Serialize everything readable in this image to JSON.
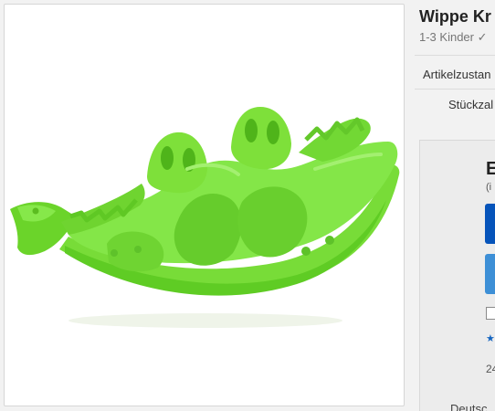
{
  "product": {
    "title": "Wippe Kr",
    "subtitle": "1-3 Kinder ✓",
    "image_alt": "Grüne Krokodil-Wippe",
    "image_color": "#7ee03a"
  },
  "details": {
    "condition_label": "Artikelzustan",
    "quantity_label": "Stückzal"
  },
  "buybox": {
    "price_initial": "E",
    "price_note": "(i",
    "rating_icon": "star-icon",
    "count_partial": "24"
  },
  "footer": {
    "label": "Deutsc"
  },
  "colors": {
    "primary_button": "#0654ba",
    "secondary_button": "#3d8fd6"
  }
}
